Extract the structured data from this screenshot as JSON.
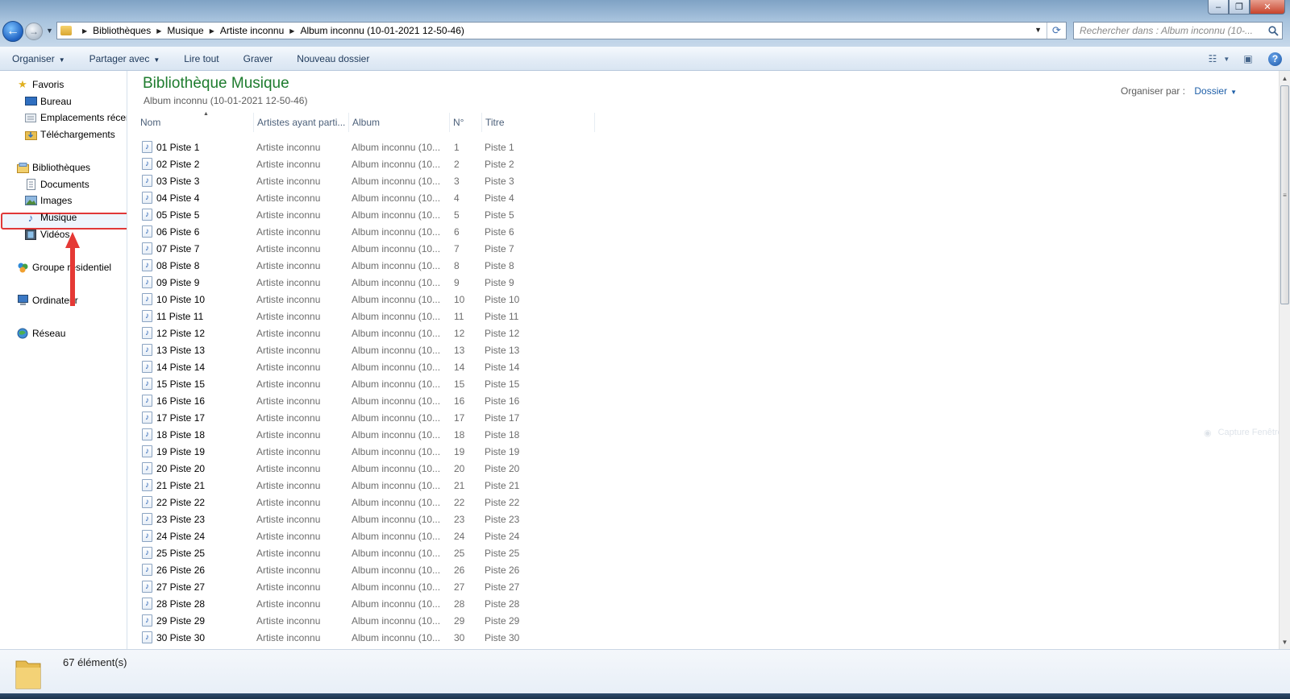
{
  "window": {
    "controls": {
      "minimize": "–",
      "maximize": "❐",
      "close": "✕"
    }
  },
  "address": {
    "crumbs": [
      "Bibliothèques",
      "Musique",
      "Artiste inconnu",
      "Album inconnu (10-01-2021 12-50-46)"
    ],
    "search_placeholder": "Rechercher dans : Album inconnu (10-..."
  },
  "toolbar": {
    "organize": "Organiser",
    "share": "Partager avec",
    "play_all": "Lire tout",
    "burn": "Graver",
    "new_folder": "Nouveau dossier"
  },
  "nav": {
    "favorites": "Favoris",
    "desktop": "Bureau",
    "recent": "Emplacements récents",
    "downloads": "Téléchargements",
    "libraries": "Bibliothèques",
    "documents": "Documents",
    "images": "Images",
    "music": "Musique",
    "videos": "Vidéos",
    "homegroup": "Groupe résidentiel",
    "computer": "Ordinateur",
    "network": "Réseau"
  },
  "library": {
    "title": "Bibliothèque Musique",
    "subtitle": "Album inconnu (10-01-2021 12-50-46)",
    "arrange_label": "Organiser par :",
    "arrange_value": "Dossier"
  },
  "columns": {
    "name": "Nom",
    "artists": "Artistes ayant parti...",
    "album": "Album",
    "number": "N°",
    "title": "Titre"
  },
  "rows": [
    {
      "name": "01 Piste 1",
      "artist": "Artiste inconnu",
      "album": "Album inconnu (10...",
      "num": "1",
      "title": "Piste 1"
    },
    {
      "name": "02 Piste 2",
      "artist": "Artiste inconnu",
      "album": "Album inconnu (10...",
      "num": "2",
      "title": "Piste 2"
    },
    {
      "name": "03 Piste 3",
      "artist": "Artiste inconnu",
      "album": "Album inconnu (10...",
      "num": "3",
      "title": "Piste 3"
    },
    {
      "name": "04 Piste 4",
      "artist": "Artiste inconnu",
      "album": "Album inconnu (10...",
      "num": "4",
      "title": "Piste 4"
    },
    {
      "name": "05 Piste 5",
      "artist": "Artiste inconnu",
      "album": "Album inconnu (10...",
      "num": "5",
      "title": "Piste 5"
    },
    {
      "name": "06 Piste 6",
      "artist": "Artiste inconnu",
      "album": "Album inconnu (10...",
      "num": "6",
      "title": "Piste 6"
    },
    {
      "name": "07 Piste 7",
      "artist": "Artiste inconnu",
      "album": "Album inconnu (10...",
      "num": "7",
      "title": "Piste 7"
    },
    {
      "name": "08 Piste 8",
      "artist": "Artiste inconnu",
      "album": "Album inconnu (10...",
      "num": "8",
      "title": "Piste 8"
    },
    {
      "name": "09 Piste 9",
      "artist": "Artiste inconnu",
      "album": "Album inconnu (10...",
      "num": "9",
      "title": "Piste 9"
    },
    {
      "name": "10 Piste 10",
      "artist": "Artiste inconnu",
      "album": "Album inconnu (10...",
      "num": "10",
      "title": "Piste 10"
    },
    {
      "name": "11 Piste 11",
      "artist": "Artiste inconnu",
      "album": "Album inconnu (10...",
      "num": "11",
      "title": "Piste 11"
    },
    {
      "name": "12 Piste 12",
      "artist": "Artiste inconnu",
      "album": "Album inconnu (10...",
      "num": "12",
      "title": "Piste 12"
    },
    {
      "name": "13 Piste 13",
      "artist": "Artiste inconnu",
      "album": "Album inconnu (10...",
      "num": "13",
      "title": "Piste 13"
    },
    {
      "name": "14 Piste 14",
      "artist": "Artiste inconnu",
      "album": "Album inconnu (10...",
      "num": "14",
      "title": "Piste 14"
    },
    {
      "name": "15 Piste 15",
      "artist": "Artiste inconnu",
      "album": "Album inconnu (10...",
      "num": "15",
      "title": "Piste 15"
    },
    {
      "name": "16 Piste 16",
      "artist": "Artiste inconnu",
      "album": "Album inconnu (10...",
      "num": "16",
      "title": "Piste 16"
    },
    {
      "name": "17 Piste 17",
      "artist": "Artiste inconnu",
      "album": "Album inconnu (10...",
      "num": "17",
      "title": "Piste 17"
    },
    {
      "name": "18 Piste 18",
      "artist": "Artiste inconnu",
      "album": "Album inconnu (10...",
      "num": "18",
      "title": "Piste 18"
    },
    {
      "name": "19 Piste 19",
      "artist": "Artiste inconnu",
      "album": "Album inconnu (10...",
      "num": "19",
      "title": "Piste 19"
    },
    {
      "name": "20 Piste 20",
      "artist": "Artiste inconnu",
      "album": "Album inconnu (10...",
      "num": "20",
      "title": "Piste 20"
    },
    {
      "name": "21 Piste 21",
      "artist": "Artiste inconnu",
      "album": "Album inconnu (10...",
      "num": "21",
      "title": "Piste 21"
    },
    {
      "name": "22 Piste 22",
      "artist": "Artiste inconnu",
      "album": "Album inconnu (10...",
      "num": "22",
      "title": "Piste 22"
    },
    {
      "name": "23 Piste 23",
      "artist": "Artiste inconnu",
      "album": "Album inconnu (10...",
      "num": "23",
      "title": "Piste 23"
    },
    {
      "name": "24 Piste 24",
      "artist": "Artiste inconnu",
      "album": "Album inconnu (10...",
      "num": "24",
      "title": "Piste 24"
    },
    {
      "name": "25 Piste 25",
      "artist": "Artiste inconnu",
      "album": "Album inconnu (10...",
      "num": "25",
      "title": "Piste 25"
    },
    {
      "name": "26 Piste 26",
      "artist": "Artiste inconnu",
      "album": "Album inconnu (10...",
      "num": "26",
      "title": "Piste 26"
    },
    {
      "name": "27 Piste 27",
      "artist": "Artiste inconnu",
      "album": "Album inconnu (10...",
      "num": "27",
      "title": "Piste 27"
    },
    {
      "name": "28 Piste 28",
      "artist": "Artiste inconnu",
      "album": "Album inconnu (10...",
      "num": "28",
      "title": "Piste 28"
    },
    {
      "name": "29 Piste 29",
      "artist": "Artiste inconnu",
      "album": "Album inconnu (10...",
      "num": "29",
      "title": "Piste 29"
    },
    {
      "name": "30 Piste 30",
      "artist": "Artiste inconnu",
      "album": "Album inconnu (10...",
      "num": "30",
      "title": "Piste 30"
    }
  ],
  "status": {
    "count": "67 élément(s)"
  },
  "watermark": "Capture Fenêtre",
  "colors": {
    "library_title": "#1e7c2e",
    "highlight": "#e03838",
    "link": "#1e5fa8"
  }
}
